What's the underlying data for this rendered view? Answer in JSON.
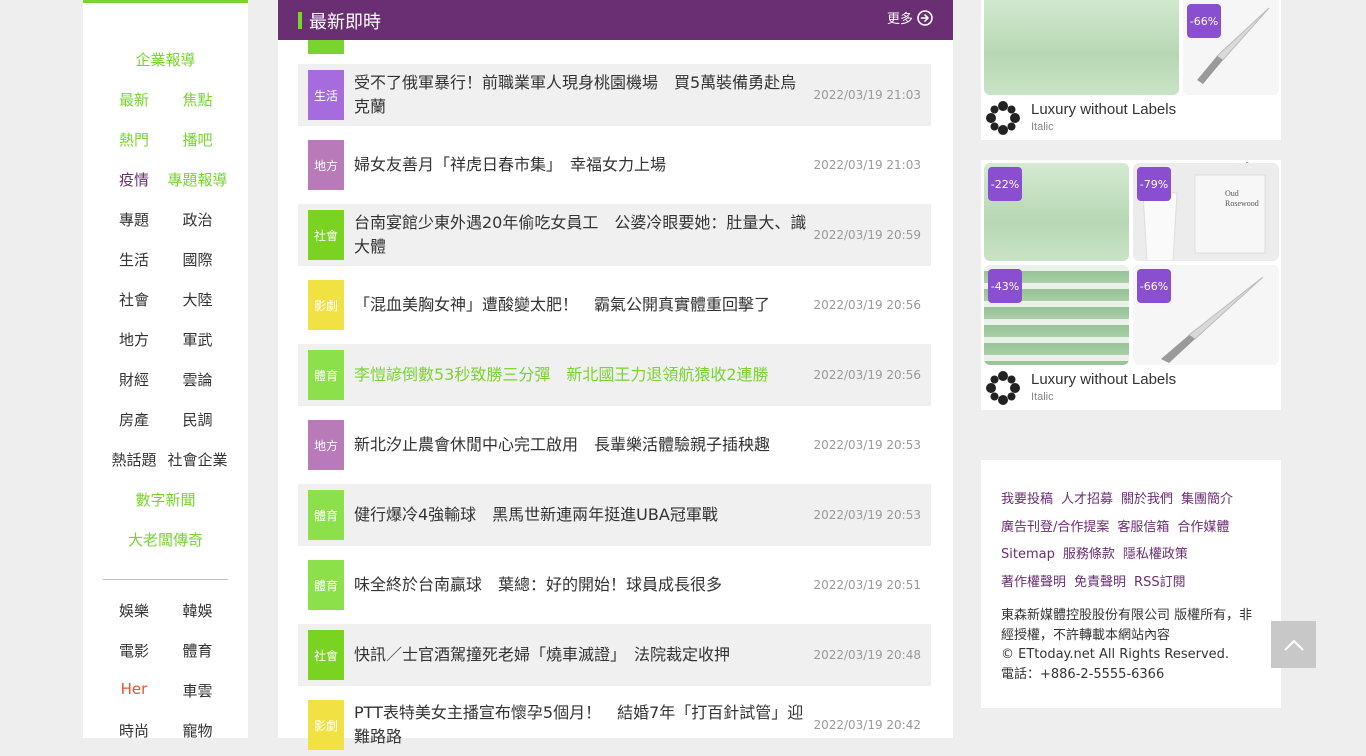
{
  "sidebar": {
    "items": [
      {
        "label": "企業報導",
        "color": "green"
      },
      {
        "label": "最新",
        "color": "green"
      },
      {
        "label": "焦點",
        "color": "green"
      },
      {
        "label": "熱門",
        "color": "green"
      },
      {
        "label": "播吧",
        "color": "green"
      },
      {
        "label": "疫情",
        "color": "purple"
      },
      {
        "label": "專題報導",
        "color": "green"
      },
      {
        "label": "專題",
        "color": "dark"
      },
      {
        "label": "政治",
        "color": "dark"
      },
      {
        "label": "生活",
        "color": "dark"
      },
      {
        "label": "國際",
        "color": "dark"
      },
      {
        "label": "社會",
        "color": "dark"
      },
      {
        "label": "大陸",
        "color": "dark"
      },
      {
        "label": "地方",
        "color": "dark"
      },
      {
        "label": "軍武",
        "color": "dark"
      },
      {
        "label": "財經",
        "color": "dark"
      },
      {
        "label": "雲論",
        "color": "dark"
      },
      {
        "label": "房產",
        "color": "dark"
      },
      {
        "label": "民調",
        "color": "dark"
      },
      {
        "label": "熱話題",
        "color": "dark"
      },
      {
        "label": "社會企業",
        "color": "dark"
      },
      {
        "label": "數字新聞",
        "color": "green"
      },
      {
        "label": "大老闆傳奇",
        "color": "green"
      },
      {
        "label": "娛樂",
        "color": "dark"
      },
      {
        "label": "韓娛",
        "color": "dark"
      },
      {
        "label": "電影",
        "color": "dark"
      },
      {
        "label": "體育",
        "color": "dark"
      },
      {
        "label": "Her",
        "color": "red"
      },
      {
        "label": "車雲",
        "color": "dark"
      },
      {
        "label": "時尚",
        "color": "dark"
      },
      {
        "label": "寵物",
        "color": "dark"
      }
    ]
  },
  "main": {
    "title": "最新即時",
    "more_label": "更多",
    "news": [
      {
        "category": "生活",
        "cat_color": "#a66bdc",
        "title": "受不了俄軍暴行！前職業軍人現身桃園機場　買5萬裝備勇赴烏克蘭",
        "time": "2022/03/19 21:03"
      },
      {
        "category": "地方",
        "cat_color": "#b97ab9",
        "title": "婦女友善月「祥虎日春市集」　幸福女力上場",
        "time": "2022/03/19 21:03"
      },
      {
        "category": "社會",
        "cat_color": "#7ad321",
        "title": "台南宴館少東外遇20年偷吃女員工　公婆冷眼要她：肚量大、識大體",
        "time": "2022/03/19 20:59"
      },
      {
        "category": "影劇",
        "cat_color": "#f2e142",
        "title": "「混血美胸女神」遭酸變太肥！　霸氣公開真實體重回擊了",
        "time": "2022/03/19 20:56"
      },
      {
        "category": "體育",
        "cat_color": "#8ce04a",
        "title": "李愷諺倒數53秒致勝三分彈　新北國王力退領航猿收2連勝",
        "time": "2022/03/19 20:56"
      },
      {
        "category": "地方",
        "cat_color": "#b97ab9",
        "title": "新北汐止農會休閒中心完工啟用　長輩樂活體驗親子插秧趣",
        "time": "2022/03/19 20:53"
      },
      {
        "category": "體育",
        "cat_color": "#8ce04a",
        "title": "健行爆冷4強輸球　黑馬世新連兩年挺進UBA冠軍戰",
        "time": "2022/03/19 20:53"
      },
      {
        "category": "體育",
        "cat_color": "#8ce04a",
        "title": "味全終於台南贏球　葉總：好的開始！球員成長很多",
        "time": "2022/03/19 20:51"
      },
      {
        "category": "社會",
        "cat_color": "#7ad321",
        "title": "快訊／士官酒駕撞死老婦「燒車滅證」　法院裁定收押",
        "time": "2022/03/19 20:48"
      },
      {
        "category": "影劇",
        "cat_color": "#f2e142",
        "title": "PTT表特美女主播宣布懷孕5個月！　結婚7年「打百針試管」迎難路路",
        "time": "2022/03/19 20:42"
      }
    ]
  },
  "ads": {
    "ad1": {
      "tags": [
        "-66%"
      ],
      "brand": "Luxury without Labels",
      "sub": "Italic"
    },
    "ad2": {
      "tags": [
        "-22%",
        "-79%",
        "-43%",
        "-66%"
      ],
      "brand": "Luxury without Labels",
      "sub": "Italic",
      "mug_text": "Oud Rosewood"
    }
  },
  "footer": {
    "links": [
      "我要投稿",
      "人才招募",
      "關於我們",
      "集團簡介",
      "廣告刊登/合作提案",
      "客服信箱",
      "合作媒體",
      "Sitemap",
      "服務條款",
      "隱私權政策",
      "著作權聲明",
      "免責聲明",
      "RSS訂閱"
    ],
    "copyright": [
      "東森新媒體控股股份有限公司 版權所有，非經授權，不許轉載本網站內容",
      "© ETtoday.net All Rights Reserved.",
      "電話：+886-2-5555-6366"
    ]
  },
  "icons": {
    "more": "arrow-circle-right-icon",
    "back_to_top": "chevron-up-icon",
    "ad_choices": "ad-choices-icon",
    "ad_close": "close-icon"
  },
  "colors": {
    "brand_purple": "#6a2e72",
    "brand_green": "#79d430",
    "highlight_red": "#e8552b"
  }
}
